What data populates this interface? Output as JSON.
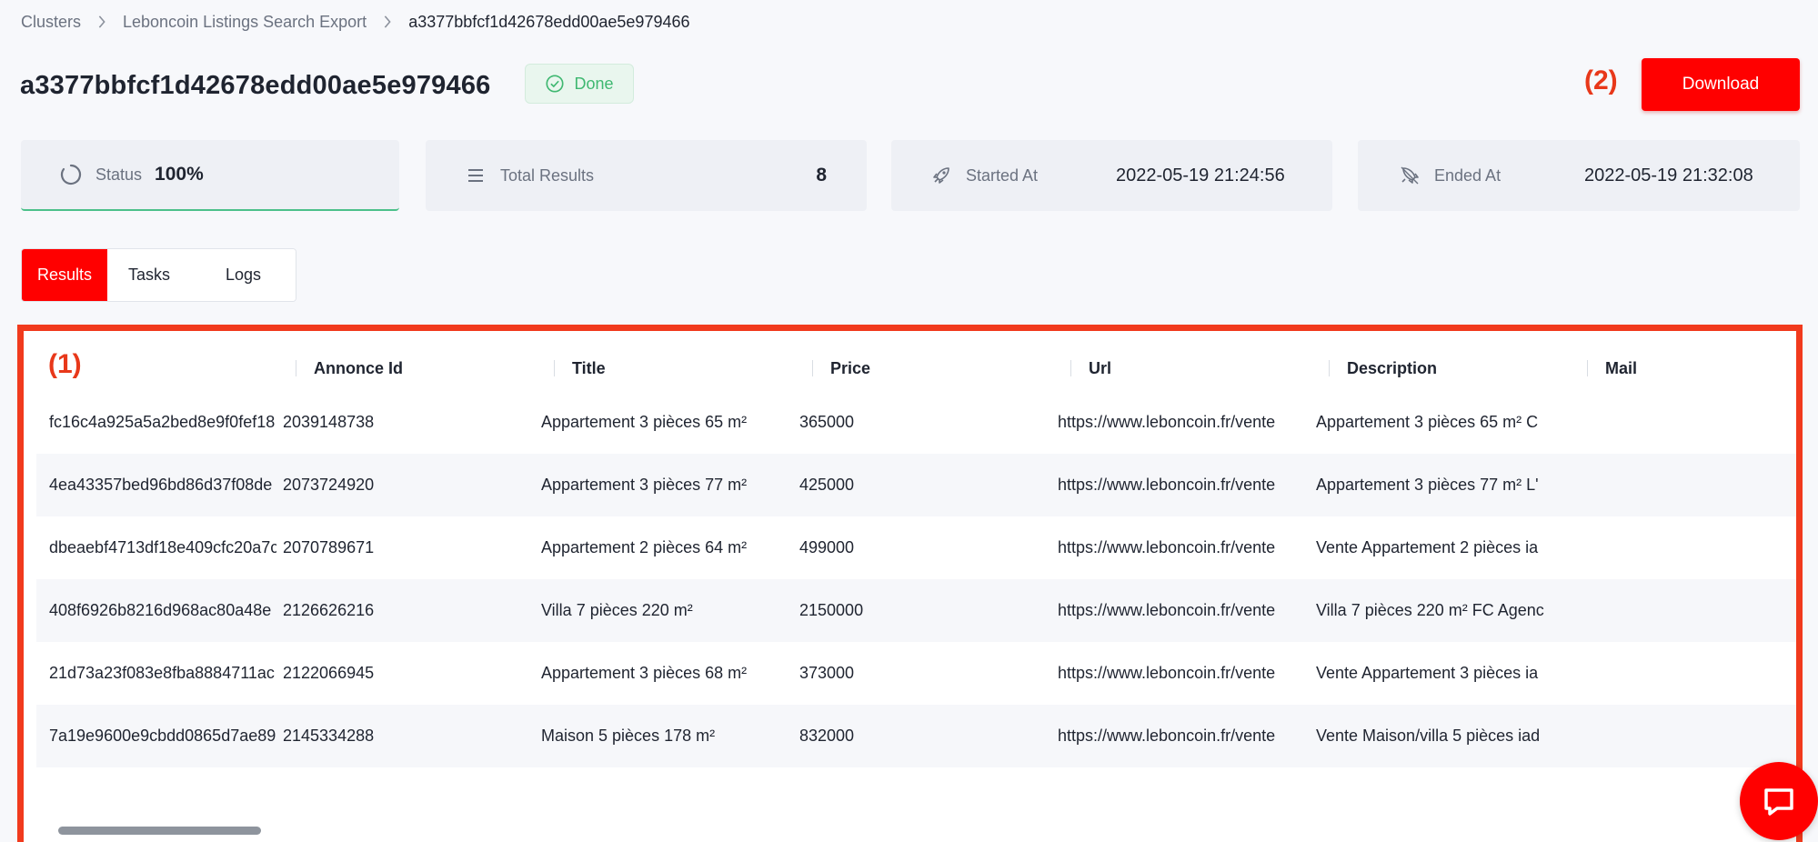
{
  "breadcrumb": [
    "Clusters",
    "Leboncoin Listings Search Export",
    "a3377bbfcf1d42678edd00ae5e979466"
  ],
  "header": {
    "title": "a3377bbfcf1d42678edd00ae5e979466",
    "status_badge": "Done",
    "annotation_2": "(2)",
    "download_label": "Download"
  },
  "stats": {
    "status_label": "Status",
    "status_value": "100%",
    "total_label": "Total Results",
    "total_value": "8",
    "started_label": "Started At",
    "started_value": "2022-05-19 21:24:56",
    "ended_label": "Ended At",
    "ended_value": "2022-05-19 21:32:08"
  },
  "tabs": [
    {
      "label": "Results",
      "active": true
    },
    {
      "label": "Tasks",
      "active": false
    },
    {
      "label": "Logs",
      "active": false
    }
  ],
  "table": {
    "annotation_1": "(1)",
    "columns": [
      "",
      "Annonce Id",
      "Title",
      "Price",
      "Url",
      "Description",
      "Mail"
    ],
    "rows": [
      [
        "fc16c4a925a5a2bed8e9f0fef18",
        "2039148738",
        "Appartement 3 pièces 65 m²",
        "365000",
        "https://www.leboncoin.fr/vente",
        "Appartement 3 pièces 65 m² C",
        ""
      ],
      [
        "4ea43357bed96bd86d37f08de",
        "2073724920",
        "Appartement 3 pièces 77 m²",
        "425000",
        "https://www.leboncoin.fr/vente",
        "Appartement 3 pièces 77 m² L'",
        ""
      ],
      [
        "dbeaebf4713df18e409cfc20a7c",
        "2070789671",
        "Appartement 2 pièces 64 m²",
        "499000",
        "https://www.leboncoin.fr/vente",
        "Vente Appartement 2 pièces ia",
        ""
      ],
      [
        "408f6926b8216d968ac80a48e",
        "2126626216",
        "Villa 7 pièces 220 m²",
        "2150000",
        "https://www.leboncoin.fr/vente",
        "Villa 7 pièces 220 m² FC Agenc",
        ""
      ],
      [
        "21d73a23f083e8fba8884711ac",
        "2122066945",
        "Appartement 3 pièces 68 m²",
        "373000",
        "https://www.leboncoin.fr/vente",
        "Vente Appartement 3 pièces ia",
        ""
      ],
      [
        "7a19e9600e9cbdd0865d7ae89",
        "2145334288",
        "Maison 5 pièces 178 m²",
        "832000",
        "https://www.leboncoin.fr/vente",
        "Vente Maison/villa 5 pièces iad",
        ""
      ]
    ]
  },
  "colors": {
    "accent": "#ff0000",
    "success": "#3fb871",
    "annotation": "#e8381a"
  }
}
